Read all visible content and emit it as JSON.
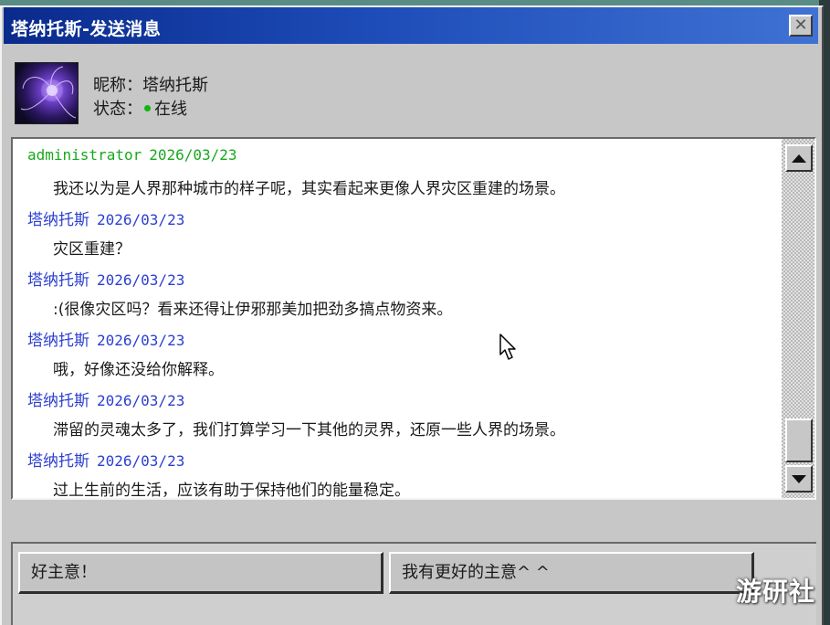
{
  "window": {
    "title": "塔纳托斯-发送消息",
    "close_glyph": "✕"
  },
  "contact": {
    "nickname_line": "昵称：塔纳托斯",
    "status_label": "状态：",
    "status_value": "在线",
    "status_color": "#12b412"
  },
  "messages": [
    {
      "sender": "administrator",
      "date": "2026/03/23",
      "text": "我还以为是人界那种城市的样子呢，其实看起来更像人界灾区重建的场景。",
      "kind": "admin"
    },
    {
      "sender": "塔纳托斯",
      "date": "2026/03/23",
      "text": "灾区重建？",
      "kind": "user"
    },
    {
      "sender": "塔纳托斯",
      "date": "2026/03/23",
      "text": ":(很像灾区吗？看来还得让伊邪那美加把劲多搞点物资来。",
      "kind": "user"
    },
    {
      "sender": "塔纳托斯",
      "date": "2026/03/23",
      "text": "哦，好像还没给你解释。",
      "kind": "user"
    },
    {
      "sender": "塔纳托斯",
      "date": "2026/03/23",
      "text": "滞留的灵魂太多了，我们打算学习一下其他的灵界，还原一些人界的场景。",
      "kind": "user"
    },
    {
      "sender": "塔纳托斯",
      "date": "2026/03/23",
      "text": "过上生前的生活，应该有助于保持他们的能量稳定。",
      "kind": "user"
    }
  ],
  "colors": {
    "admin_name": "#19a81e",
    "user_name": "#2b3fd0",
    "title_bar": "#0a2a8c"
  },
  "choices": [
    {
      "label": "好主意！"
    },
    {
      "label": "我有更好的主意^ ^"
    }
  ],
  "watermark": "游研社",
  "icons": {
    "close": "close-icon",
    "scroll_up": "arrow-up-icon",
    "scroll_down": "arrow-down-icon",
    "cursor": "mouse-cursor-icon"
  }
}
